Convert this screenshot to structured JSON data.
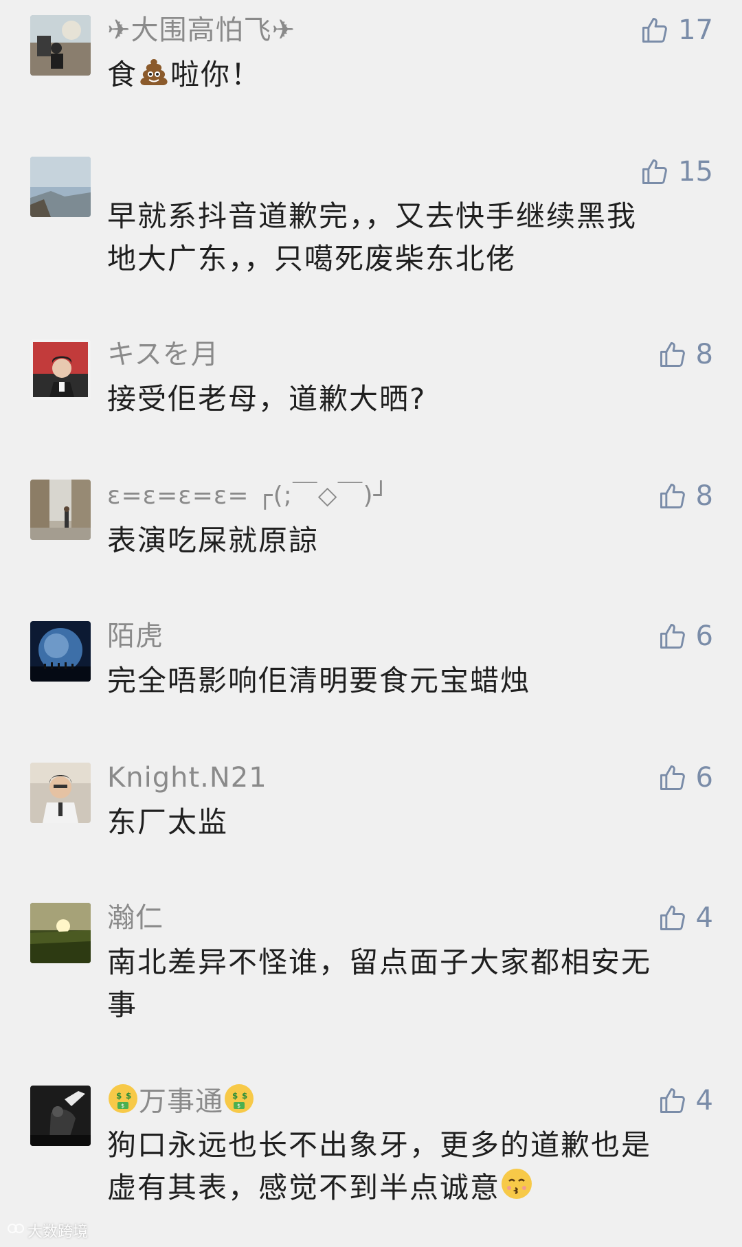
{
  "comments": [
    {
      "author_prefix": "✈",
      "author": "大围高怕飞",
      "author_suffix": "✈",
      "text_before": "食",
      "text_emoji": "poop-emoji",
      "text_after": "啦你！",
      "likes": "17"
    },
    {
      "author": "",
      "text_line1": "早就系抖音道歉完，，又去快手继续黑我",
      "text_line2": "地大广东，，只噶死废柴东北佬",
      "likes": "15"
    },
    {
      "author": "キスを月",
      "text": "接受佢老母，道歉大晒?",
      "likes": "8"
    },
    {
      "author": "ε=ε=ε=ε= ┌(;￣◇￣)┘",
      "text": "表演吃屎就原諒",
      "likes": "8"
    },
    {
      "author": "陌虎",
      "text": "完全唔影响佢清明要食元宝蜡烛",
      "likes": "6"
    },
    {
      "author": "Knight.N21",
      "text": "东厂太监",
      "likes": "6"
    },
    {
      "author": "瀚仁",
      "text_line1": "南北差异不怪谁，留点面子大家都相安无",
      "text_line2": "事",
      "likes": "4"
    },
    {
      "author_prefix_emoji": "money-mouth-emoji",
      "author": "万事通",
      "author_suffix_emoji": "money-mouth-emoji",
      "text_line1": "狗口永远也长不出象牙，更多的道歉也是",
      "text_line2": "虚有其表，感觉不到半点诚意",
      "text_emoji": "kissing-emoji",
      "likes": "4"
    }
  ],
  "watermark": "大数跨境",
  "icons": {
    "like": "thumbs-up-outline-icon"
  },
  "colors": {
    "background": "#f0f0f0",
    "text": "#1f1f1f",
    "author": "#8a8a8a",
    "like": "#7a8ca8"
  }
}
